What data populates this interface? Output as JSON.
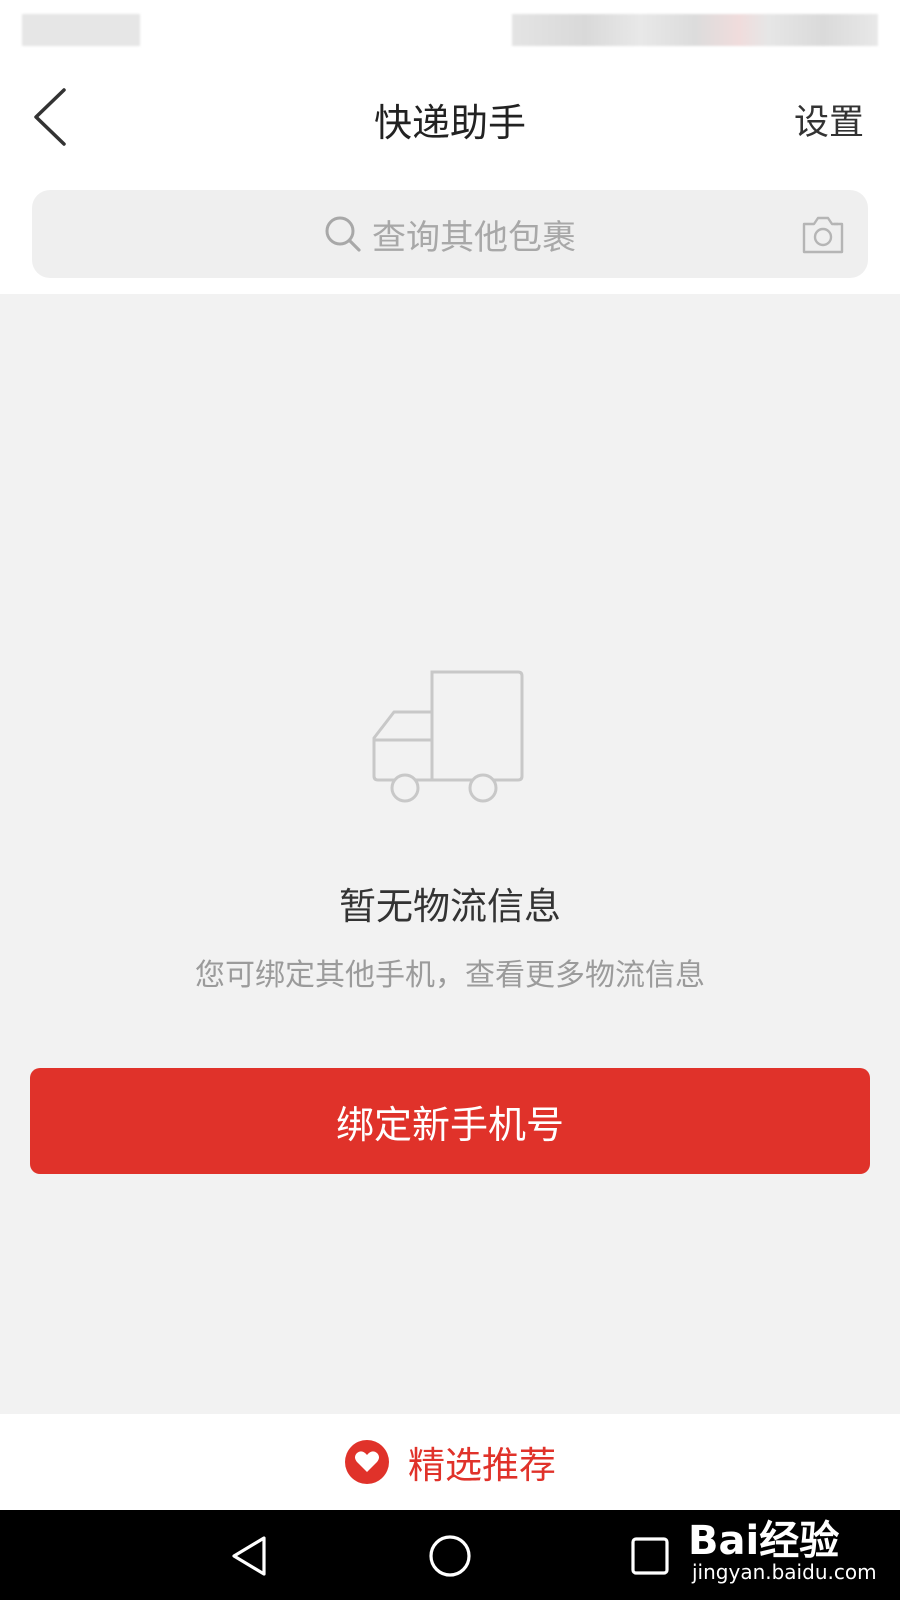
{
  "header": {
    "title": "快递助手",
    "settings_label": "设置"
  },
  "search": {
    "placeholder": "查询其他包裹"
  },
  "empty_state": {
    "title": "暂无物流信息",
    "subtitle": "您可绑定其他手机，查看更多物流信息"
  },
  "bind_button": {
    "label": "绑定新手机号"
  },
  "recommend": {
    "label": "精选推荐"
  },
  "watermark": {
    "logo": "Bai经验",
    "url": "jingyan.baidu.com"
  },
  "colors": {
    "accent": "#e0322a",
    "background": "#f2f2f2"
  },
  "icons": {
    "back": "back-arrow-icon",
    "search": "search-icon",
    "camera": "camera-icon",
    "truck": "truck-icon",
    "heart": "heart-icon",
    "nav_back": "triangle-back-icon",
    "nav_home": "circle-home-icon",
    "nav_recent": "square-recent-icon"
  }
}
